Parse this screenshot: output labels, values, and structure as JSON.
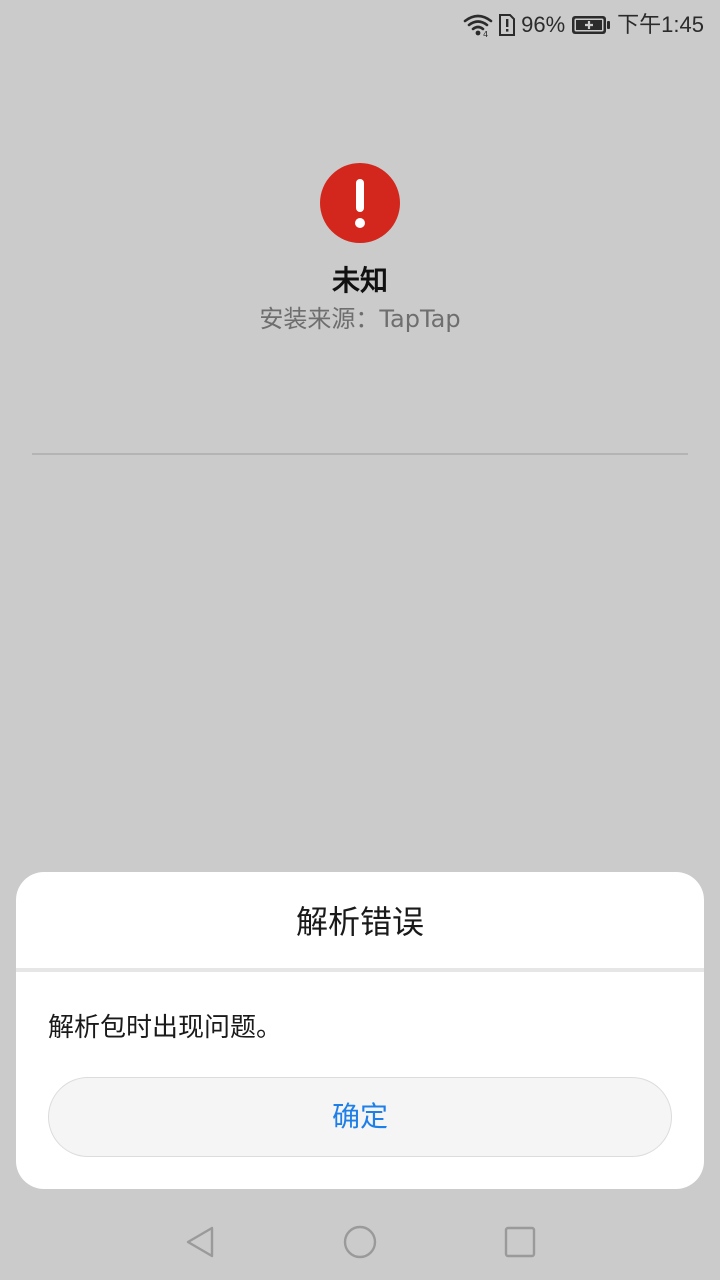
{
  "status_bar": {
    "battery_percent": "96%",
    "time": "下午1:45"
  },
  "app": {
    "name": "未知",
    "install_source": "安装来源：TapTap"
  },
  "dialog": {
    "title": "解析错误",
    "message": "解析包时出现问题。",
    "confirm_label": "确定"
  },
  "colors": {
    "error_red": "#d3261c",
    "accent_blue": "#1f7fe8",
    "background": "#cbcbcb"
  },
  "icons": {
    "wifi": "wifi-icon",
    "sim": "sim-alert-icon",
    "battery": "battery-charging-icon",
    "error": "exclamation-icon",
    "back": "back-triangle-icon",
    "home": "home-circle-icon",
    "recents": "recents-square-icon"
  }
}
